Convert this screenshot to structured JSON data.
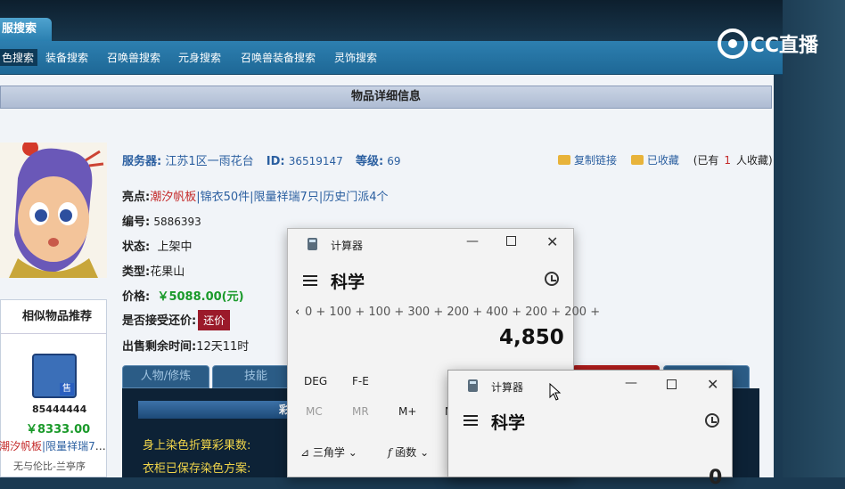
{
  "top_tab": {
    "label": "服搜索"
  },
  "nav": {
    "items": [
      {
        "label": "色搜索",
        "active": true
      },
      {
        "label": "装备搜索"
      },
      {
        "label": "召唤兽搜索"
      },
      {
        "label": "元身搜索"
      },
      {
        "label": "召唤兽装备搜索"
      },
      {
        "label": "灵饰搜索"
      }
    ]
  },
  "watermark": {
    "text": "CC直播"
  },
  "detail": {
    "title": "物品详细信息",
    "server_label": "服务器:",
    "server_value": "江苏1区一雨花台",
    "id_label": "ID:",
    "id_value": "36519147",
    "level_label": "等级:",
    "level_value": "69",
    "copy_link": "复制链接",
    "favorited": "已收藏",
    "fav_count_pre": "(已有",
    "fav_count": "1",
    "fav_count_post": "人收藏)",
    "highlight_label": "亮点:",
    "highlights": [
      "潮汐帆板",
      "锦衣50件",
      "限量祥瑞7只",
      "历史门派4个"
    ],
    "number_label": "编号:",
    "number_value": "5886393",
    "status_label": "状态:",
    "status_value": "上架中",
    "type_label": "类型:",
    "type_value": "花果山",
    "price_label": "价格:",
    "price_value": "￥5088.00(元)",
    "bargain_label": "是否接受还价:",
    "bargain_button": "还价",
    "remaining_label": "出售剩余时间:",
    "remaining_value": "12天11时"
  },
  "similar": {
    "header": "相似物品推荐",
    "item_id": "85444444",
    "item_price": "￥8333.00",
    "item_tag1": "潮汐帆板",
    "item_tag2": "限量祥瑞7",
    "item_server": "无与伦比-兰亭序"
  },
  "tabs": [
    "人物/修炼",
    "技能"
  ],
  "panel": {
    "header": "彩果染",
    "line1": "身上染色折算彩果数:",
    "line2": "衣柜已保存染色方案:"
  },
  "calc1": {
    "title": "计算器",
    "mode": "科学",
    "expression": "0 + 100 + 100 + 300 + 200 + 400 + 200 + 200 +",
    "result": "4,850",
    "deg": "DEG",
    "fe": "F-E",
    "mc": "MC",
    "mr": "MR",
    "mplus": "M+",
    "m": "M",
    "trig": "三角学",
    "func": "函数"
  },
  "calc2": {
    "title": "计算器",
    "mode": "科学",
    "result": "0"
  }
}
